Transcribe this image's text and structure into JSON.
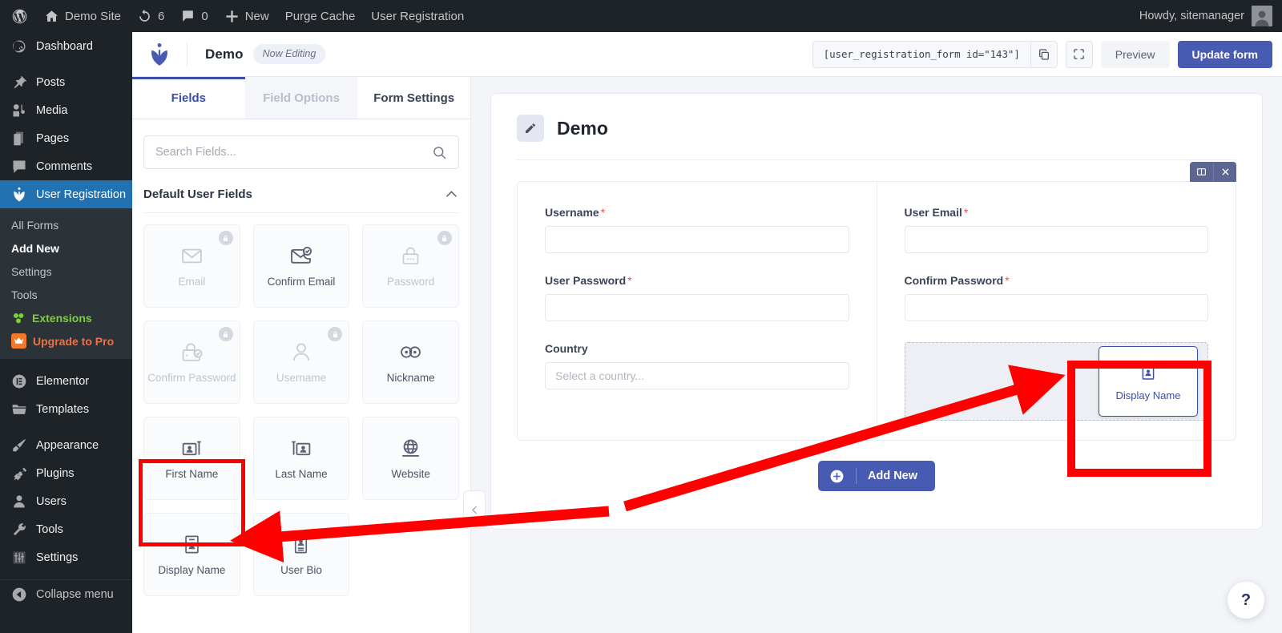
{
  "adminbar": {
    "site_name": "Demo Site",
    "revisions_count": "6",
    "comments_count": "0",
    "new_label": "New",
    "purge_cache_label": "Purge Cache",
    "user_registration_label": "User Registration",
    "howdy": "Howdy, sitemanager"
  },
  "sidebar": {
    "items": [
      {
        "label": "Dashboard",
        "icon": "dashboard-icon"
      },
      {
        "label": "Posts",
        "icon": "pin-icon"
      },
      {
        "label": "Media",
        "icon": "media-icon"
      },
      {
        "label": "Pages",
        "icon": "pages-icon"
      },
      {
        "label": "Comments",
        "icon": "comment-icon"
      },
      {
        "label": "User Registration",
        "icon": "user-registration-icon",
        "active": true
      }
    ],
    "submenu": [
      {
        "label": "All Forms"
      },
      {
        "label": "Add New",
        "current": true
      },
      {
        "label": "Settings"
      },
      {
        "label": "Tools"
      },
      {
        "label": "Extensions",
        "style": "ext"
      },
      {
        "label": "Upgrade to Pro",
        "style": "pro"
      }
    ],
    "items2": [
      {
        "label": "Elementor",
        "icon": "elementor-icon"
      },
      {
        "label": "Templates",
        "icon": "folder-icon"
      }
    ],
    "items3": [
      {
        "label": "Appearance",
        "icon": "brush-icon"
      },
      {
        "label": "Plugins",
        "icon": "plug-icon"
      },
      {
        "label": "Users",
        "icon": "user-icon"
      },
      {
        "label": "Tools",
        "icon": "wrench-icon"
      },
      {
        "label": "Settings",
        "icon": "sliders-icon"
      }
    ],
    "collapse_label": "Collapse menu"
  },
  "header": {
    "form_name": "Demo",
    "now_editing": "Now Editing",
    "shortcode": "[user_registration_form id=\"143\"]",
    "preview_label": "Preview",
    "update_label": "Update form"
  },
  "tabs": [
    {
      "label": "Fields",
      "state": "active"
    },
    {
      "label": "Field Options",
      "state": "disabled"
    },
    {
      "label": "Form Settings",
      "state": "normal"
    }
  ],
  "search": {
    "placeholder": "Search Fields...",
    "value": ""
  },
  "fields_section": {
    "title": "Default User Fields",
    "cards": [
      {
        "label": "Email",
        "icon": "envelope-icon",
        "locked": true
      },
      {
        "label": "Confirm Email",
        "icon": "envelope-check-icon",
        "locked": false
      },
      {
        "label": "Password",
        "icon": "password-icon",
        "locked": true
      },
      {
        "label": "Confirm Password",
        "icon": "password-check-icon",
        "locked": true
      },
      {
        "label": "Username",
        "icon": "person-icon",
        "locked": true
      },
      {
        "label": "Nickname",
        "icon": "glasses-icon",
        "locked": false
      },
      {
        "label": "First Name",
        "icon": "id-card-right-icon",
        "locked": false
      },
      {
        "label": "Last Name",
        "icon": "id-card-left-icon",
        "locked": false
      },
      {
        "label": "Website",
        "icon": "globe-icon",
        "locked": false
      },
      {
        "label": "Display Name",
        "icon": "id-badge-icon",
        "locked": false,
        "highlighted": true
      },
      {
        "label": "User Bio",
        "icon": "bio-icon",
        "locked": false
      }
    ]
  },
  "preview": {
    "title": "Demo",
    "left_column": [
      {
        "label": "Username",
        "required": true,
        "type": "text",
        "placeholder": ""
      },
      {
        "label": "User Password",
        "required": true,
        "type": "text",
        "placeholder": ""
      },
      {
        "label": "Country",
        "required": false,
        "type": "select",
        "placeholder": "Select a country..."
      }
    ],
    "right_column": [
      {
        "label": "User Email",
        "required": true,
        "type": "text",
        "placeholder": ""
      },
      {
        "label": "Confirm Password",
        "required": true,
        "type": "text",
        "placeholder": ""
      }
    ],
    "drag_card": {
      "label": "Display Name",
      "icon": "id-badge-icon"
    },
    "row_toolbar": [
      {
        "icon": "columns-icon",
        "name": "row-columns-button"
      },
      {
        "icon": "close-icon",
        "name": "row-delete-button"
      }
    ],
    "add_new_label": "Add New",
    "help_label": "?"
  },
  "colors": {
    "accent": "#475bb2",
    "tab_active": "#3b4eaa",
    "wp_blue": "#2271b1",
    "annotation_red": "#fe0000",
    "required_red": "#f04e4e",
    "extensions_green": "#7ad03a",
    "pro_orange": "#e8734a"
  }
}
